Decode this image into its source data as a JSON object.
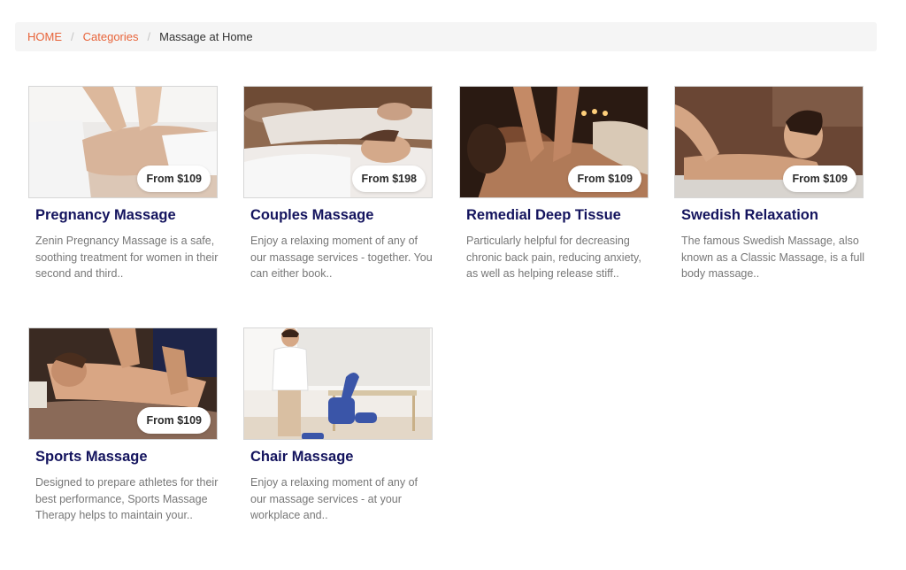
{
  "breadcrumb": {
    "home": "HOME",
    "categories": "Categories",
    "current": "Massage at Home",
    "separator": "/"
  },
  "services": [
    {
      "title": "Pregnancy Massage",
      "price": "From $109",
      "description": "Zenin Pregnancy Massage is a safe, soothing treatment for women in their second and third..",
      "image": "pregnancy-massage-photo"
    },
    {
      "title": "Couples Massage",
      "price": "From $198",
      "description": "Enjoy a relaxing moment of any of our massage services - together. You can either book..",
      "image": "couples-massage-photo"
    },
    {
      "title": "Remedial Deep Tissue",
      "price": "From $109",
      "description": "Particularly helpful for decreasing chronic back pain, reducing anxiety, as well as helping release stiff..",
      "image": "deep-tissue-massage-photo"
    },
    {
      "title": "Swedish Relaxation",
      "price": "From $109",
      "description": "The famous Swedish Massage, also known as a Classic Massage, is a full body massage..",
      "image": "swedish-massage-photo"
    },
    {
      "title": "Sports Massage",
      "price": "From $109",
      "description": "Designed to prepare athletes for their best performance, Sports Massage Therapy helps to maintain your..",
      "image": "sports-massage-photo"
    },
    {
      "title": "Chair Massage",
      "price": "",
      "description": "Enjoy a relaxing moment of any of our massage services - at your workplace and..",
      "image": "chair-massage-photo"
    }
  ],
  "colors": {
    "link": "#e8643a",
    "title": "#14145e",
    "text": "#777777"
  }
}
